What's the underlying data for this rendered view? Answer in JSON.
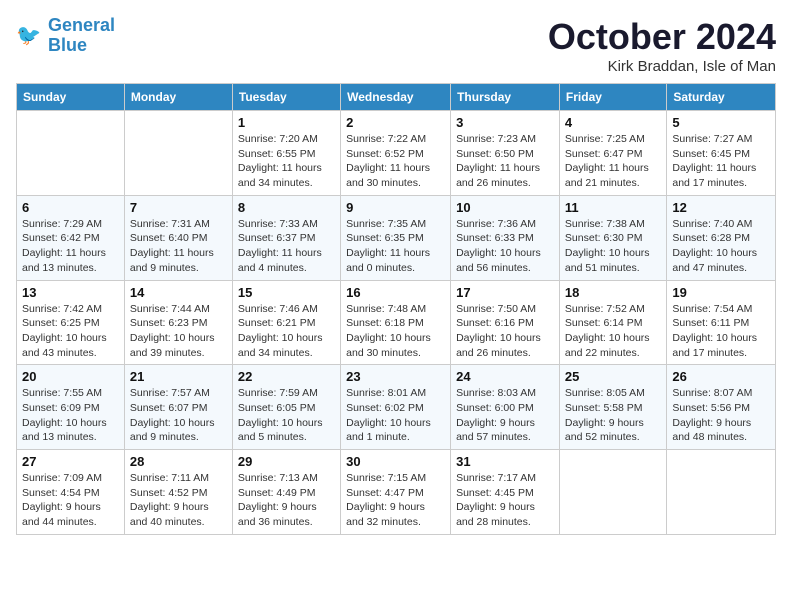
{
  "header": {
    "logo_line1": "General",
    "logo_line2": "Blue",
    "month_title": "October 2024",
    "location": "Kirk Braddan, Isle of Man"
  },
  "weekdays": [
    "Sunday",
    "Monday",
    "Tuesday",
    "Wednesday",
    "Thursday",
    "Friday",
    "Saturday"
  ],
  "weeks": [
    [
      {
        "day": "",
        "sunrise": "",
        "sunset": "",
        "daylight": ""
      },
      {
        "day": "",
        "sunrise": "",
        "sunset": "",
        "daylight": ""
      },
      {
        "day": "1",
        "sunrise": "Sunrise: 7:20 AM",
        "sunset": "Sunset: 6:55 PM",
        "daylight": "Daylight: 11 hours and 34 minutes."
      },
      {
        "day": "2",
        "sunrise": "Sunrise: 7:22 AM",
        "sunset": "Sunset: 6:52 PM",
        "daylight": "Daylight: 11 hours and 30 minutes."
      },
      {
        "day": "3",
        "sunrise": "Sunrise: 7:23 AM",
        "sunset": "Sunset: 6:50 PM",
        "daylight": "Daylight: 11 hours and 26 minutes."
      },
      {
        "day": "4",
        "sunrise": "Sunrise: 7:25 AM",
        "sunset": "Sunset: 6:47 PM",
        "daylight": "Daylight: 11 hours and 21 minutes."
      },
      {
        "day": "5",
        "sunrise": "Sunrise: 7:27 AM",
        "sunset": "Sunset: 6:45 PM",
        "daylight": "Daylight: 11 hours and 17 minutes."
      }
    ],
    [
      {
        "day": "6",
        "sunrise": "Sunrise: 7:29 AM",
        "sunset": "Sunset: 6:42 PM",
        "daylight": "Daylight: 11 hours and 13 minutes."
      },
      {
        "day": "7",
        "sunrise": "Sunrise: 7:31 AM",
        "sunset": "Sunset: 6:40 PM",
        "daylight": "Daylight: 11 hours and 9 minutes."
      },
      {
        "day": "8",
        "sunrise": "Sunrise: 7:33 AM",
        "sunset": "Sunset: 6:37 PM",
        "daylight": "Daylight: 11 hours and 4 minutes."
      },
      {
        "day": "9",
        "sunrise": "Sunrise: 7:35 AM",
        "sunset": "Sunset: 6:35 PM",
        "daylight": "Daylight: 11 hours and 0 minutes."
      },
      {
        "day": "10",
        "sunrise": "Sunrise: 7:36 AM",
        "sunset": "Sunset: 6:33 PM",
        "daylight": "Daylight: 10 hours and 56 minutes."
      },
      {
        "day": "11",
        "sunrise": "Sunrise: 7:38 AM",
        "sunset": "Sunset: 6:30 PM",
        "daylight": "Daylight: 10 hours and 51 minutes."
      },
      {
        "day": "12",
        "sunrise": "Sunrise: 7:40 AM",
        "sunset": "Sunset: 6:28 PM",
        "daylight": "Daylight: 10 hours and 47 minutes."
      }
    ],
    [
      {
        "day": "13",
        "sunrise": "Sunrise: 7:42 AM",
        "sunset": "Sunset: 6:25 PM",
        "daylight": "Daylight: 10 hours and 43 minutes."
      },
      {
        "day": "14",
        "sunrise": "Sunrise: 7:44 AM",
        "sunset": "Sunset: 6:23 PM",
        "daylight": "Daylight: 10 hours and 39 minutes."
      },
      {
        "day": "15",
        "sunrise": "Sunrise: 7:46 AM",
        "sunset": "Sunset: 6:21 PM",
        "daylight": "Daylight: 10 hours and 34 minutes."
      },
      {
        "day": "16",
        "sunrise": "Sunrise: 7:48 AM",
        "sunset": "Sunset: 6:18 PM",
        "daylight": "Daylight: 10 hours and 30 minutes."
      },
      {
        "day": "17",
        "sunrise": "Sunrise: 7:50 AM",
        "sunset": "Sunset: 6:16 PM",
        "daylight": "Daylight: 10 hours and 26 minutes."
      },
      {
        "day": "18",
        "sunrise": "Sunrise: 7:52 AM",
        "sunset": "Sunset: 6:14 PM",
        "daylight": "Daylight: 10 hours and 22 minutes."
      },
      {
        "day": "19",
        "sunrise": "Sunrise: 7:54 AM",
        "sunset": "Sunset: 6:11 PM",
        "daylight": "Daylight: 10 hours and 17 minutes."
      }
    ],
    [
      {
        "day": "20",
        "sunrise": "Sunrise: 7:55 AM",
        "sunset": "Sunset: 6:09 PM",
        "daylight": "Daylight: 10 hours and 13 minutes."
      },
      {
        "day": "21",
        "sunrise": "Sunrise: 7:57 AM",
        "sunset": "Sunset: 6:07 PM",
        "daylight": "Daylight: 10 hours and 9 minutes."
      },
      {
        "day": "22",
        "sunrise": "Sunrise: 7:59 AM",
        "sunset": "Sunset: 6:05 PM",
        "daylight": "Daylight: 10 hours and 5 minutes."
      },
      {
        "day": "23",
        "sunrise": "Sunrise: 8:01 AM",
        "sunset": "Sunset: 6:02 PM",
        "daylight": "Daylight: 10 hours and 1 minute."
      },
      {
        "day": "24",
        "sunrise": "Sunrise: 8:03 AM",
        "sunset": "Sunset: 6:00 PM",
        "daylight": "Daylight: 9 hours and 57 minutes."
      },
      {
        "day": "25",
        "sunrise": "Sunrise: 8:05 AM",
        "sunset": "Sunset: 5:58 PM",
        "daylight": "Daylight: 9 hours and 52 minutes."
      },
      {
        "day": "26",
        "sunrise": "Sunrise: 8:07 AM",
        "sunset": "Sunset: 5:56 PM",
        "daylight": "Daylight: 9 hours and 48 minutes."
      }
    ],
    [
      {
        "day": "27",
        "sunrise": "Sunrise: 7:09 AM",
        "sunset": "Sunset: 4:54 PM",
        "daylight": "Daylight: 9 hours and 44 minutes."
      },
      {
        "day": "28",
        "sunrise": "Sunrise: 7:11 AM",
        "sunset": "Sunset: 4:52 PM",
        "daylight": "Daylight: 9 hours and 40 minutes."
      },
      {
        "day": "29",
        "sunrise": "Sunrise: 7:13 AM",
        "sunset": "Sunset: 4:49 PM",
        "daylight": "Daylight: 9 hours and 36 minutes."
      },
      {
        "day": "30",
        "sunrise": "Sunrise: 7:15 AM",
        "sunset": "Sunset: 4:47 PM",
        "daylight": "Daylight: 9 hours and 32 minutes."
      },
      {
        "day": "31",
        "sunrise": "Sunrise: 7:17 AM",
        "sunset": "Sunset: 4:45 PM",
        "daylight": "Daylight: 9 hours and 28 minutes."
      },
      {
        "day": "",
        "sunrise": "",
        "sunset": "",
        "daylight": ""
      },
      {
        "day": "",
        "sunrise": "",
        "sunset": "",
        "daylight": ""
      }
    ]
  ]
}
